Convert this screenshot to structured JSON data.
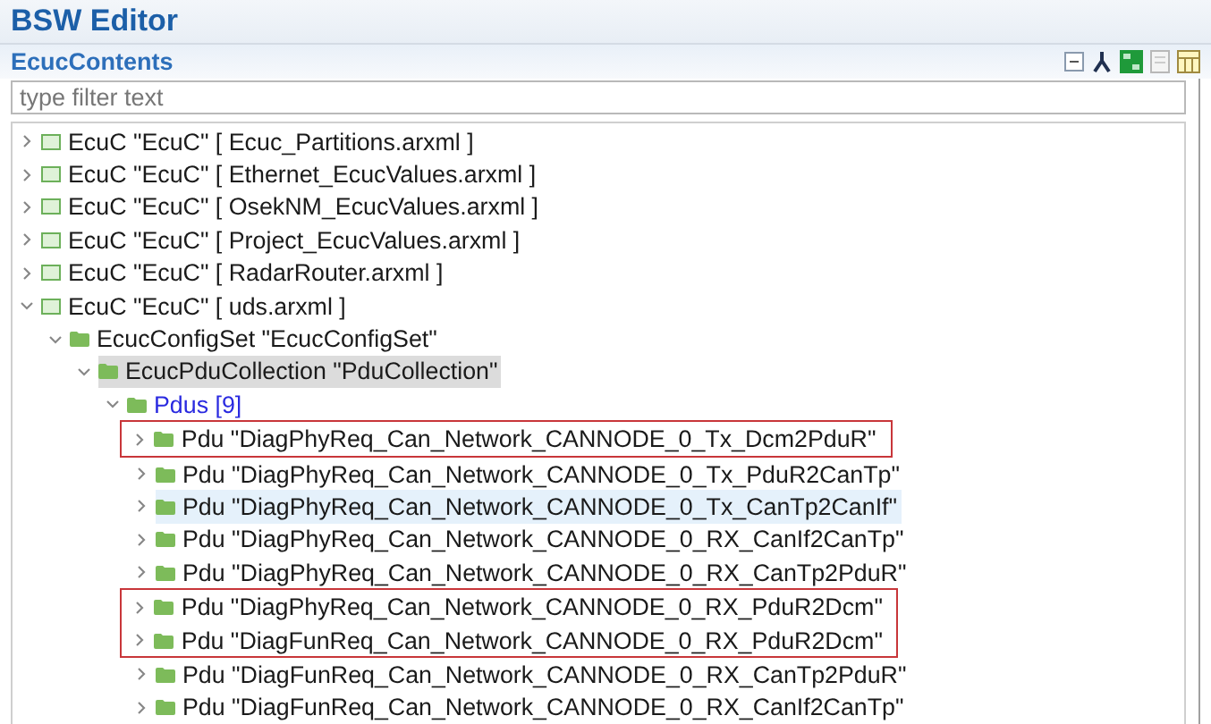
{
  "editor": {
    "title": "BSW Editor"
  },
  "section": {
    "title": "EcucContents"
  },
  "filter": {
    "placeholder": "type filter text"
  },
  "tree": [
    {
      "kind": "file",
      "label": "EcuC \"EcuC\" [ Ecuc_Partitions.arxml ]",
      "expanded": false
    },
    {
      "kind": "file",
      "label": "EcuC \"EcuC\" [ Ethernet_EcucValues.arxml ]",
      "expanded": false
    },
    {
      "kind": "file",
      "label": "EcuC \"EcuC\" [ OsekNM_EcucValues.arxml ]",
      "expanded": false
    },
    {
      "kind": "file",
      "label": "EcuC \"EcuC\" [ Project_EcucValues.arxml ]",
      "expanded": false
    },
    {
      "kind": "file",
      "label": "EcuC \"EcuC\" [ RadarRouter.arxml ]",
      "expanded": false
    },
    {
      "kind": "file",
      "label": "EcuC \"EcuC\" [ uds.arxml ]",
      "expanded": true,
      "children": [
        {
          "kind": "folder",
          "label": "EcucConfigSet \"EcucConfigSet\"",
          "expanded": true,
          "children": [
            {
              "kind": "folder",
              "label": "EcucPduCollection \"PduCollection\"",
              "expanded": true,
              "selected": true,
              "children": [
                {
                  "kind": "list",
                  "label": "Pdus [9]",
                  "expanded": true,
                  "children": [
                    {
                      "kind": "folder",
                      "label": "Pdu \"DiagPhyReq_Can_Network_CANNODE_0_Tx_Dcm2PduR\"",
                      "expanded": false,
                      "outlined": true
                    },
                    {
                      "kind": "folder",
                      "label": "Pdu \"DiagPhyReq_Can_Network_CANNODE_0_Tx_PduR2CanTp\"",
                      "expanded": false
                    },
                    {
                      "kind": "folder",
                      "label": "Pdu \"DiagPhyReq_Can_Network_CANNODE_0_Tx_CanTp2CanIf\"",
                      "expanded": false,
                      "hovered": true
                    },
                    {
                      "kind": "folder",
                      "label": "Pdu \"DiagPhyReq_Can_Network_CANNODE_0_RX_CanIf2CanTp\"",
                      "expanded": false
                    },
                    {
                      "kind": "folder",
                      "label": "Pdu \"DiagPhyReq_Can_Network_CANNODE_0_RX_CanTp2PduR\"",
                      "expanded": false
                    },
                    {
                      "kind": "folder",
                      "label": "Pdu \"DiagPhyReq_Can_Network_CANNODE_0_RX_PduR2Dcm\"",
                      "expanded": false,
                      "outlined": true
                    },
                    {
                      "kind": "folder",
                      "label": "Pdu \"DiagFunReq_Can_Network_CANNODE_0_RX_PduR2Dcm\"",
                      "expanded": false,
                      "outlined": true
                    },
                    {
                      "kind": "folder",
                      "label": "Pdu \"DiagFunReq_Can_Network_CANNODE_0_RX_CanTp2PduR\"",
                      "expanded": false
                    },
                    {
                      "kind": "folder",
                      "label": "Pdu \"DiagFunReq_Can_Network_CANNODE_0_RX_CanIf2CanTp\"",
                      "expanded": false
                    }
                  ]
                }
              ]
            }
          ]
        }
      ]
    }
  ]
}
